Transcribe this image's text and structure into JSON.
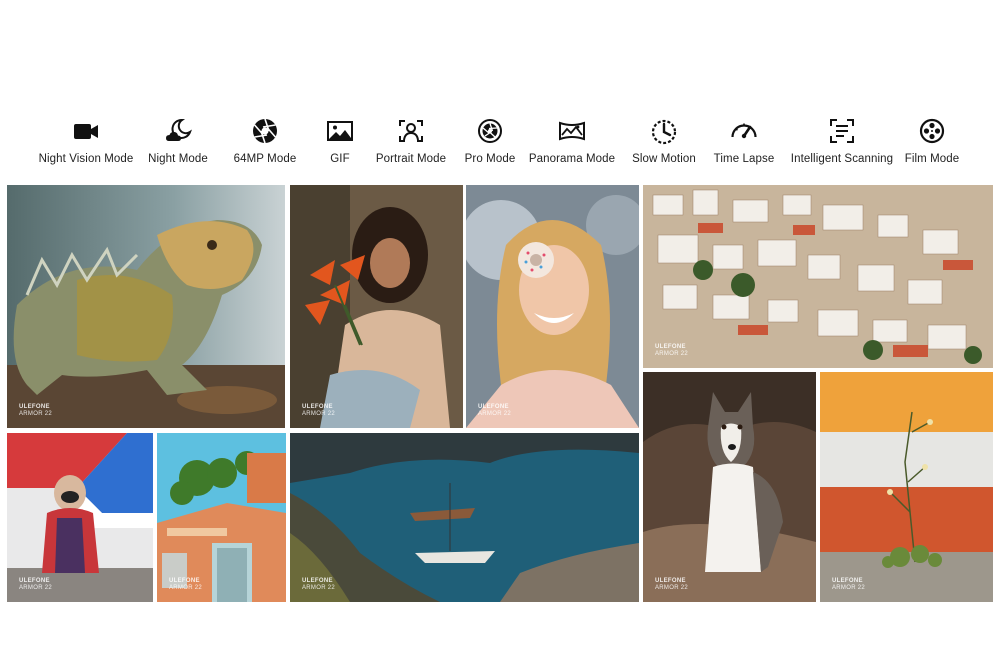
{
  "camera_modes": [
    {
      "label": "Night Vision Mode",
      "icon": "night-vision-camera-icon"
    },
    {
      "label": "Night Mode",
      "icon": "moon-cloud-icon"
    },
    {
      "label": "64MP Mode",
      "icon": "aperture-icon"
    },
    {
      "label": "GIF",
      "icon": "image-icon"
    },
    {
      "label": "Portrait Mode",
      "icon": "portrait-frame-icon"
    },
    {
      "label": "Pro Mode",
      "icon": "pro-shutter-icon"
    },
    {
      "label": "Panorama Mode",
      "icon": "panorama-icon"
    },
    {
      "label": "Slow Motion",
      "icon": "slow-motion-icon"
    },
    {
      "label": "Time Lapse",
      "icon": "speedometer-icon"
    },
    {
      "label": "Intelligent Scanning",
      "icon": "scan-icon"
    },
    {
      "label": "Film Mode",
      "icon": "film-reel-icon"
    }
  ],
  "watermark": {
    "brand": "ULEFONE",
    "model": "ARMOR 22"
  },
  "photos": [
    {
      "subject": "iguana"
    },
    {
      "subject": "woman-with-flowers"
    },
    {
      "subject": "woman-with-donut"
    },
    {
      "subject": "coastal-town"
    },
    {
      "subject": "dog-in-hoodie"
    },
    {
      "subject": "building-with-plants"
    },
    {
      "subject": "boats-at-sea"
    },
    {
      "subject": "husky-on-rocks"
    },
    {
      "subject": "plant-by-wall"
    }
  ],
  "colors": {
    "text": "#222222",
    "icon": "#111111",
    "background": "#ffffff"
  }
}
